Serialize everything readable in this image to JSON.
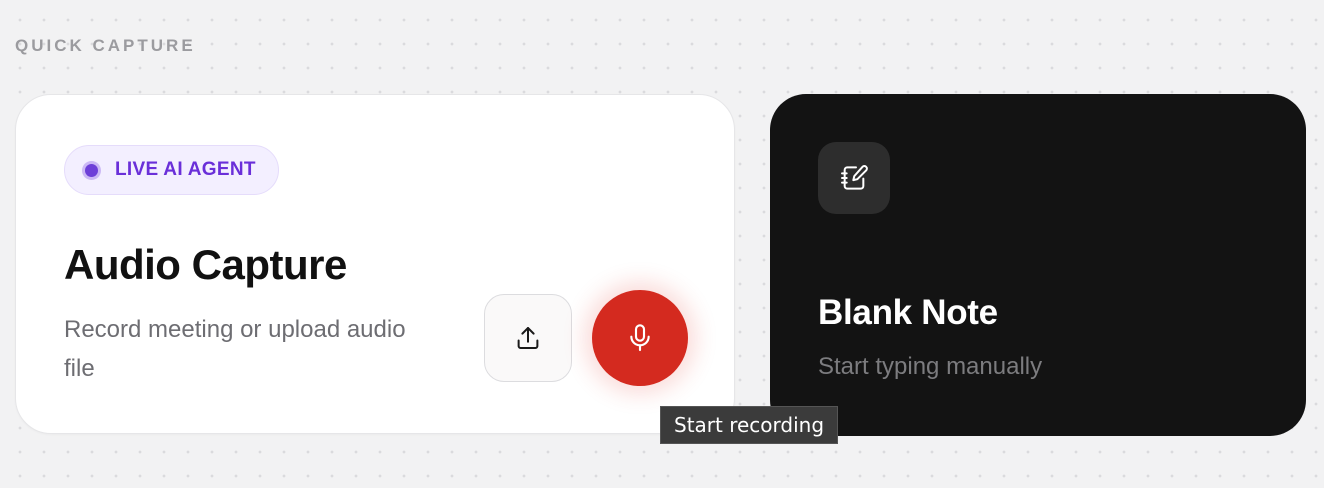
{
  "section": {
    "label": "QUICK CAPTURE"
  },
  "audio_card": {
    "badge_label": "LIVE AI AGENT",
    "title": "Audio Capture",
    "subtitle": "Record meeting or upload audio file",
    "upload_icon": "upload-icon",
    "record_icon": "microphone-icon",
    "badge_color": "#6a2fd9",
    "record_color": "#d42a1f"
  },
  "blank_card": {
    "icon": "notebook-pen-icon",
    "title": "Blank Note",
    "subtitle": "Start typing manually",
    "background": "#131313"
  },
  "tooltip": {
    "text": "Start recording"
  }
}
